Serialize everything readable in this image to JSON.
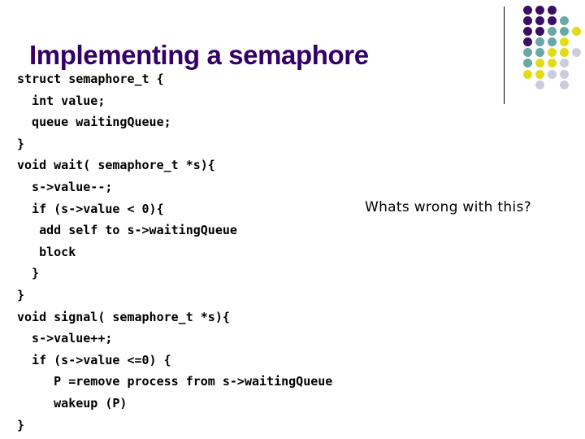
{
  "slide": {
    "title": "Implementing a semaphore",
    "background_color": "#ffffff",
    "title_color": "#330066"
  },
  "code": {
    "language": "c",
    "text_color": "#000000",
    "lines": [
      "struct semaphore_t {",
      "  int value;",
      "  queue waitingQueue;",
      "}",
      "void wait( semaphore_t *s){",
      "  s->value--;",
      "  if (s->value < 0){",
      "   add self to s->waitingQueue",
      "   block",
      "  }",
      "}",
      "void signal( semaphore_t *s){",
      "  s->value++;",
      "  if (s->value <=0) {",
      "     P =remove process from s->waitingQueue",
      "     wakeup (P)",
      "}"
    ]
  },
  "annotation": {
    "text": "Whats wrong with this?"
  },
  "decoration": {
    "divider_color": "#000000",
    "palette": {
      "purple": "#3b0f63",
      "teal": "#6aa8a8",
      "yellow": "#e0dd16",
      "lavender": "#ccccdd",
      "none": "transparent"
    },
    "dot_grid": [
      [
        "purple",
        "purple",
        "purple",
        "none",
        "none"
      ],
      [
        "purple",
        "purple",
        "purple",
        "teal",
        "none"
      ],
      [
        "purple",
        "purple",
        "teal",
        "teal",
        "yellow"
      ],
      [
        "purple",
        "teal",
        "teal",
        "yellow",
        "none"
      ],
      [
        "teal",
        "teal",
        "yellow",
        "yellow",
        "lavender"
      ],
      [
        "teal",
        "yellow",
        "yellow",
        "lavender",
        "none"
      ],
      [
        "yellow",
        "yellow",
        "lavender",
        "lavender",
        "none"
      ],
      [
        "none",
        "lavender",
        "none",
        "lavender",
        "none"
      ]
    ]
  }
}
